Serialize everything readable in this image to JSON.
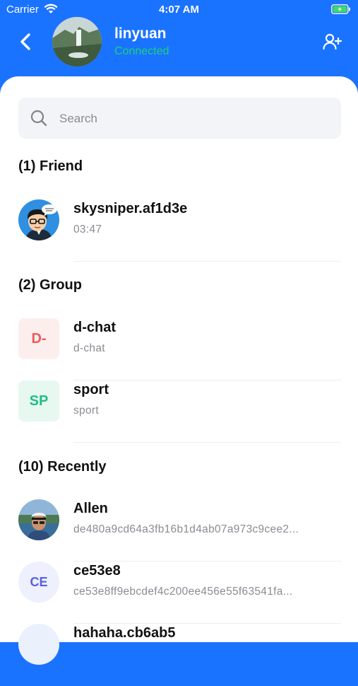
{
  "status": {
    "carrier": "Carrier",
    "time": "4:07 AM"
  },
  "header": {
    "username": "linyuan",
    "status": "Connected"
  },
  "search": {
    "placeholder": "Search"
  },
  "sections": {
    "friend": "(1) Friend",
    "group": "(2) Group",
    "recently": "(10) Recently"
  },
  "friends": [
    {
      "name": "skysniper.af1d3e",
      "sub": "03:47"
    }
  ],
  "groups": [
    {
      "badge": "D-",
      "name": "d-chat",
      "sub": "d-chat",
      "badge_color": "#ee5a5a",
      "badge_bg": "#fdeeee"
    },
    {
      "badge": "SP",
      "name": "sport",
      "sub": "sport",
      "badge_color": "#1fbf85",
      "badge_bg": "#e7f8f1"
    }
  ],
  "recent": [
    {
      "name": "Allen",
      "sub": "de480a9cd64a3fb16b1d4ab07a973c9cee2..."
    },
    {
      "badge": "CE",
      "name": "ce53e8",
      "sub": "ce53e8ff9ebcdef4c200ee456e55f63541fa...",
      "badge_color": "#5a5ee8",
      "badge_bg": "#eef0fd"
    },
    {
      "name": "hahaha.cb6ab5"
    }
  ],
  "colors": {
    "brand": "#1a73ff",
    "connected": "#19d27b"
  },
  "icons": [
    "wifi-icon",
    "battery-icon",
    "back-icon",
    "add-user-icon",
    "search-icon"
  ]
}
